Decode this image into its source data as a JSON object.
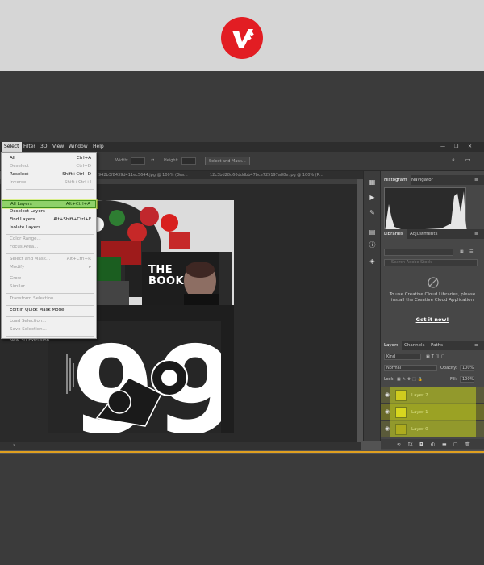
{
  "menubar": {
    "items": [
      "Select",
      "Filter",
      "3D",
      "View",
      "Window",
      "Help"
    ],
    "active": "Select"
  },
  "options_bar": {
    "width_label": "Width:",
    "height_label": "Height:",
    "select_mask_label": "Select and Mask..."
  },
  "doc_tabs": [
    "942b3f8439d411ec5644.jpg @ 100% (Gra...",
    "12c3bd28d60dddbb47bce725197a88e.jpg @ 100% (R..."
  ],
  "select_menu": {
    "items": [
      {
        "label": "All",
        "shortcut": "Ctrl+A",
        "enabled": true
      },
      {
        "label": "Deselect",
        "shortcut": "Ctrl+D",
        "enabled": false
      },
      {
        "label": "Reselect",
        "shortcut": "Shift+Ctrl+D",
        "enabled": true
      },
      {
        "label": "Inverse",
        "shortcut": "Shift+Ctrl+I",
        "enabled": false
      },
      {
        "label": "All Layers",
        "shortcut": "Alt+Ctrl+A",
        "enabled": true,
        "highlighted": true
      },
      {
        "label": "Deselect Layers",
        "shortcut": "",
        "enabled": true
      },
      {
        "label": "Find Layers",
        "shortcut": "Alt+Shift+Ctrl+F",
        "enabled": true
      },
      {
        "label": "Isolate Layers",
        "shortcut": "",
        "enabled": true
      },
      {
        "label": "Color Range...",
        "shortcut": "",
        "enabled": false
      },
      {
        "label": "Focus Area...",
        "shortcut": "",
        "enabled": false
      },
      {
        "label": "Select and Mask...",
        "shortcut": "Alt+Ctrl+R",
        "enabled": false
      },
      {
        "label": "Modify",
        "shortcut": "▸",
        "enabled": false
      },
      {
        "label": "Grow",
        "shortcut": "",
        "enabled": false
      },
      {
        "label": "Similar",
        "shortcut": "",
        "enabled": false
      },
      {
        "label": "Transform Selection",
        "shortcut": "",
        "enabled": false
      },
      {
        "label": "Edit in Quick Mask Mode",
        "shortcut": "",
        "enabled": true
      },
      {
        "label": "Load Selection...",
        "shortcut": "",
        "enabled": false
      },
      {
        "label": "Save Selection...",
        "shortcut": "",
        "enabled": false
      },
      {
        "label": "New 3D Extrusion",
        "shortcut": "",
        "enabled": false
      }
    ]
  },
  "artwork": {
    "book_title_line1": "THE",
    "book_title_line2": "BOOK",
    "big_number": "99"
  },
  "panels": {
    "histogram_tabs": [
      "Histogram",
      "Navigator"
    ],
    "library_tabs": [
      "Libraries",
      "Adjustments"
    ],
    "library_search_placeholder": "Search Adobe Stock",
    "cc_message": "To use Creative Cloud Libraries, please install the Creative Cloud Application",
    "cc_link": "Get it now!",
    "layers_tabs": [
      "Layers",
      "Channels",
      "Paths"
    ],
    "kind_label": "Kind",
    "blend_mode": "Normal",
    "opacity_label": "Opacity:",
    "opacity_value": "100%",
    "lock_label": "Lock:",
    "fill_label": "Fill:",
    "fill_value": "100%",
    "layers": [
      "Layer 2",
      "Layer 1",
      "Layer 0"
    ]
  },
  "colors": {
    "brand_red": "#e21d23",
    "highlight_green": "#8fd16a",
    "layer_highlight": "#d7e61d"
  }
}
